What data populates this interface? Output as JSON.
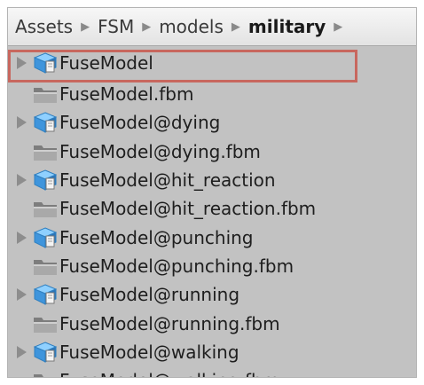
{
  "breadcrumb": {
    "items": [
      "Assets",
      "FSM",
      "models",
      "military"
    ],
    "separator": "▶"
  },
  "files": [
    {
      "label": "FuseModel",
      "type": "model",
      "expandable": true,
      "highlighted": true
    },
    {
      "label": "FuseModel.fbm",
      "type": "folder",
      "expandable": false
    },
    {
      "label": "FuseModel@dying",
      "type": "model",
      "expandable": true
    },
    {
      "label": "FuseModel@dying.fbm",
      "type": "folder",
      "expandable": false
    },
    {
      "label": "FuseModel@hit_reaction",
      "type": "model",
      "expandable": true
    },
    {
      "label": "FuseModel@hit_reaction.fbm",
      "type": "folder",
      "expandable": false
    },
    {
      "label": "FuseModel@punching",
      "type": "model",
      "expandable": true
    },
    {
      "label": "FuseModel@punching.fbm",
      "type": "folder",
      "expandable": false
    },
    {
      "label": "FuseModel@running",
      "type": "model",
      "expandable": true
    },
    {
      "label": "FuseModel@running.fbm",
      "type": "folder",
      "expandable": false
    },
    {
      "label": "FuseModel@walking",
      "type": "model",
      "expandable": true
    },
    {
      "label": "FuseModel@walking.fbm",
      "type": "folder",
      "expandable": false
    }
  ],
  "icons": {
    "model": "model-prefab-icon",
    "folder": "folder-icon",
    "expand": "expand-arrow-icon"
  },
  "colors": {
    "panel_bg": "#c2c2c2",
    "highlight_border": "#c8675e",
    "model_icon_blue": "#4aa3e8"
  }
}
